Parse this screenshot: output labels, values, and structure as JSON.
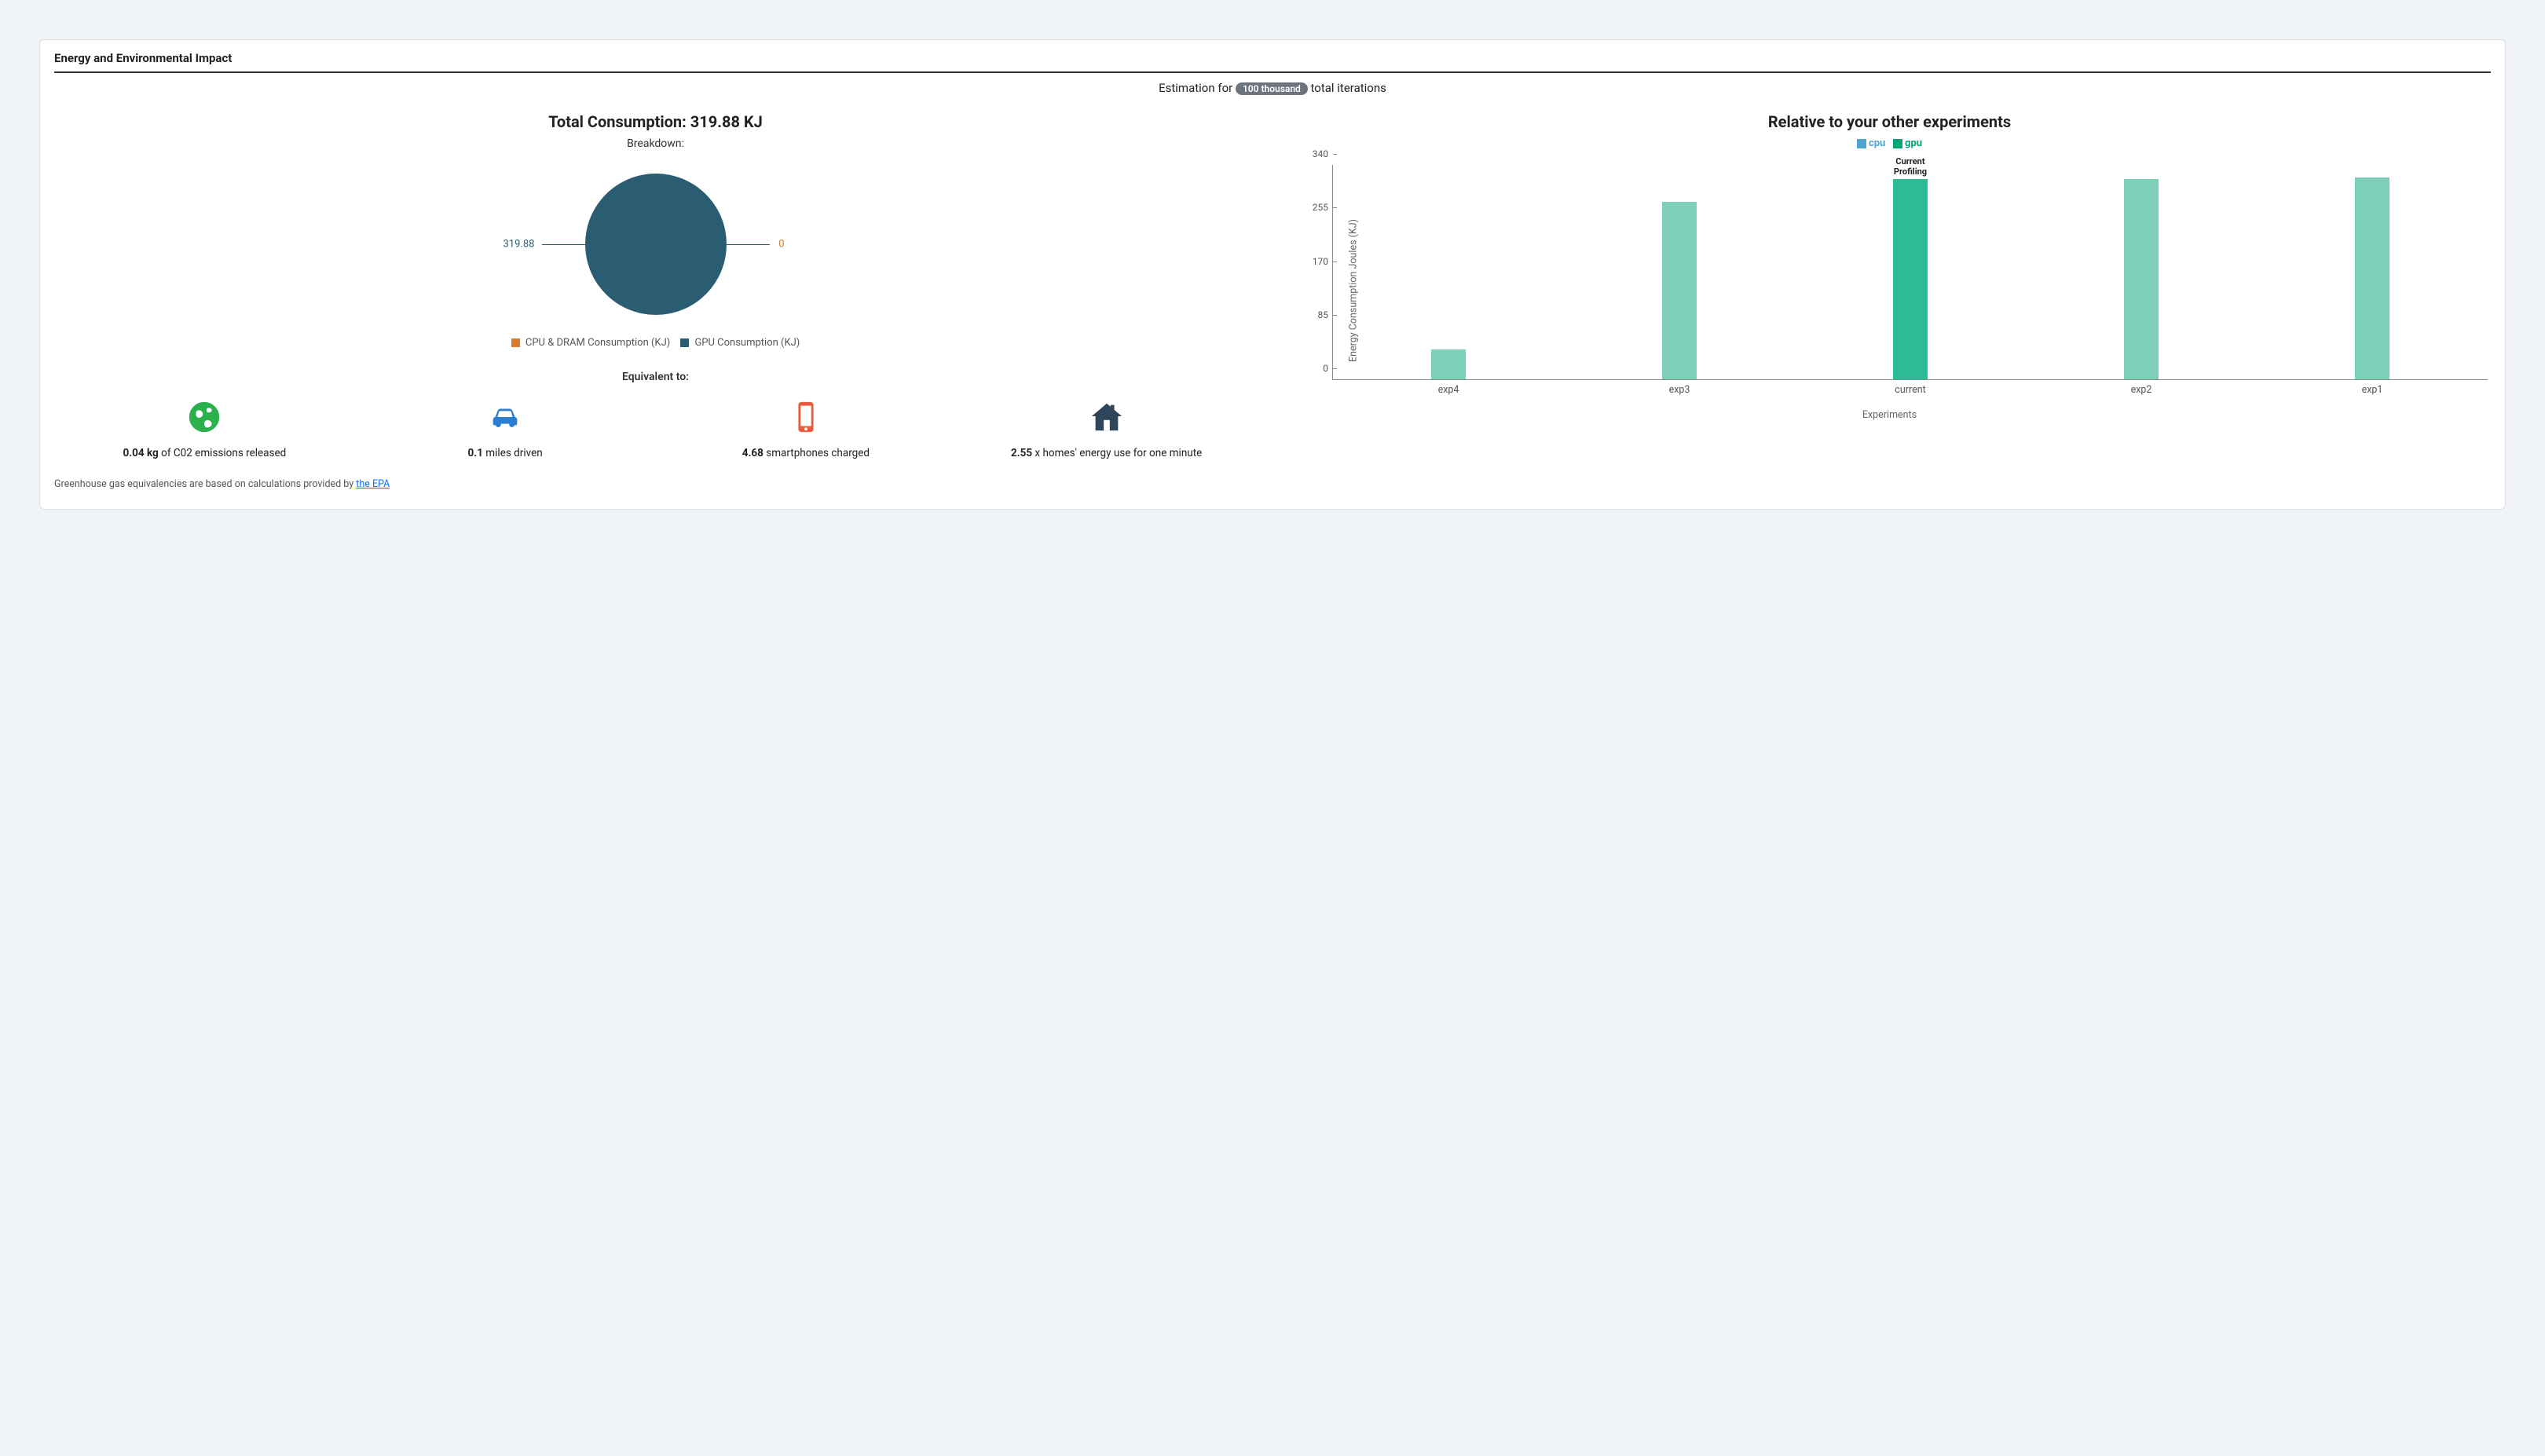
{
  "card_title": "Energy and Environmental Impact",
  "estimation": {
    "prefix": "Estimation for",
    "badge": "100 thousand",
    "suffix": "total iterations"
  },
  "left": {
    "heading_prefix": "Total Consumption:",
    "heading_value": "319.88 KJ",
    "breakdown_label": "Breakdown:",
    "pie_left_value": "319.88",
    "pie_right_value": "0",
    "legend_cpu": "CPU & DRAM Consumption (KJ)",
    "legend_gpu": "GPU Consumption (KJ)",
    "equiv_label": "Equivalent to:",
    "equiv": {
      "co2": {
        "bold": "0.04 kg",
        "rest": " of C02 emissions released"
      },
      "miles": {
        "bold": "0.1",
        "rest": " miles driven"
      },
      "phone": {
        "bold": "4.68",
        "rest": " smartphones charged"
      },
      "home": {
        "bold": "2.55",
        "rest": " x homes' energy use for one minute"
      }
    },
    "footnote_prefix": "Greenhouse gas equivalencies are based on calculations provided by ",
    "footnote_link": "the EPA"
  },
  "right": {
    "heading": "Relative to your other experiments",
    "legend_cpu": "cpu",
    "legend_gpu": "gpu",
    "ylabel": "Energy Consumption Joules (KJ)",
    "xlabel": "Experiments",
    "annotation": "Current\nProfiling"
  },
  "chart_data": [
    {
      "type": "pie",
      "title": "Total Consumption: 319.88 KJ — Breakdown",
      "series": [
        {
          "name": "CPU & DRAM Consumption (KJ)",
          "value": 0,
          "color": "#d97b29"
        },
        {
          "name": "GPU Consumption (KJ)",
          "value": 319.88,
          "color": "#2b5d72"
        }
      ]
    },
    {
      "type": "bar",
      "title": "Relative to your other experiments",
      "xlabel": "Experiments",
      "ylabel": "Energy Consumption Joules (KJ)",
      "ylim": [
        0,
        340
      ],
      "yticks": [
        0,
        85,
        170,
        255,
        340
      ],
      "categories": [
        "exp4",
        "exp3",
        "current",
        "exp2",
        "exp1"
      ],
      "series": [
        {
          "name": "cpu",
          "color": "#4fa3d1",
          "values": [
            0,
            0,
            0,
            0,
            0
          ]
        },
        {
          "name": "gpu",
          "color": "#7ccfb8",
          "values": [
            48,
            282,
            318,
            318,
            320
          ]
        }
      ],
      "highlight_category": "current",
      "highlight_color": "#2dbb96",
      "annotation": {
        "category": "current",
        "text": "Current Profiling"
      }
    }
  ]
}
